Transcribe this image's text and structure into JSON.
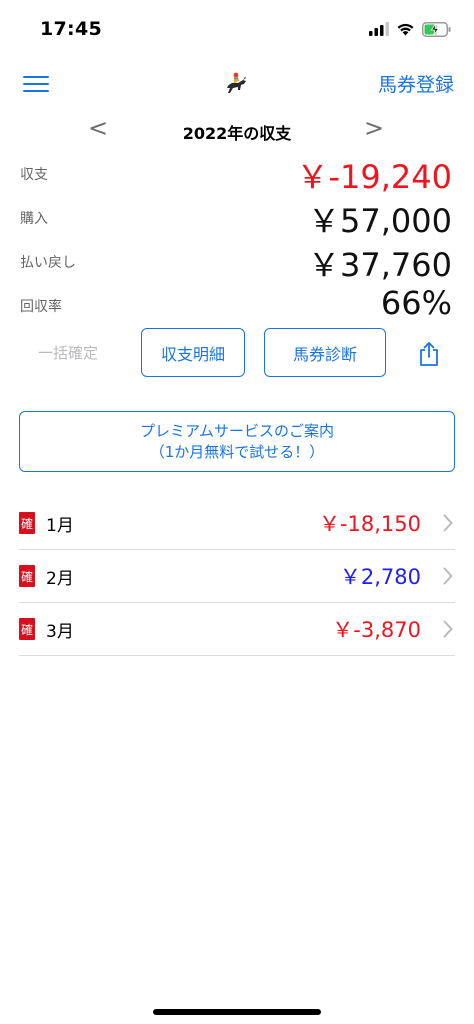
{
  "status_bar": {
    "time": "17:45"
  },
  "nav": {
    "register_label": "馬券登録",
    "logo_icon": "jockey-horse-icon",
    "menu_icon": "hamburger-menu-icon"
  },
  "year_selector": {
    "prev": "<",
    "title": "2022年の収支",
    "next": ">"
  },
  "summary": [
    {
      "label": "収支",
      "value": "￥-19,240",
      "color": "#f0141e"
    },
    {
      "label": "購入",
      "value": "￥57,000",
      "color": "#111111"
    },
    {
      "label": "払い戻し",
      "value": "￥37,760",
      "color": "#111111"
    },
    {
      "label": "回収率",
      "value": "66%",
      "color": "#111111"
    }
  ],
  "actions": {
    "bulk_confirm": "一括確定",
    "detail": "収支明細",
    "diagnose": "馬券診断",
    "share_icon": "share-icon"
  },
  "premium": {
    "line1": "プレミアムサービスのご案内",
    "line2": "（1か月無料で試せる！）"
  },
  "months": [
    {
      "badge": "確",
      "label": "1月",
      "amount": "￥-18,150",
      "color": "#f0141e"
    },
    {
      "badge": "確",
      "label": "2月",
      "amount": "￥2,780",
      "color": "#1e1ef0"
    },
    {
      "badge": "確",
      "label": "3月",
      "amount": "￥-3,870",
      "color": "#f0141e"
    }
  ],
  "colors": {
    "accent": "#1a73e8",
    "negative": "#f0141e",
    "positive": "#1e1ef0",
    "badge": "#d6101c"
  }
}
